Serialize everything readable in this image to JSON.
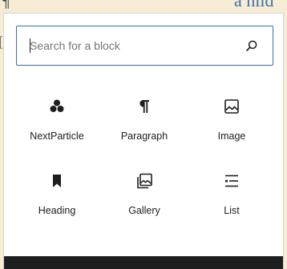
{
  "background": {
    "separator": "¶",
    "left_mark": "[",
    "link_fragment": "a hild"
  },
  "inserter": {
    "search": {
      "placeholder": "Search for a block",
      "value": ""
    },
    "blocks": [
      {
        "label": "NextParticle",
        "icon": "particles-icon"
      },
      {
        "label": "Paragraph",
        "icon": "paragraph-icon"
      },
      {
        "label": "Image",
        "icon": "image-icon"
      },
      {
        "label": "Heading",
        "icon": "bookmark-icon"
      },
      {
        "label": "Gallery",
        "icon": "gallery-icon"
      },
      {
        "label": "List",
        "icon": "list-icon"
      }
    ]
  },
  "colors": {
    "accent": "#3871a7",
    "page_background": "#f6edd4",
    "text": "#1e1e1e"
  }
}
